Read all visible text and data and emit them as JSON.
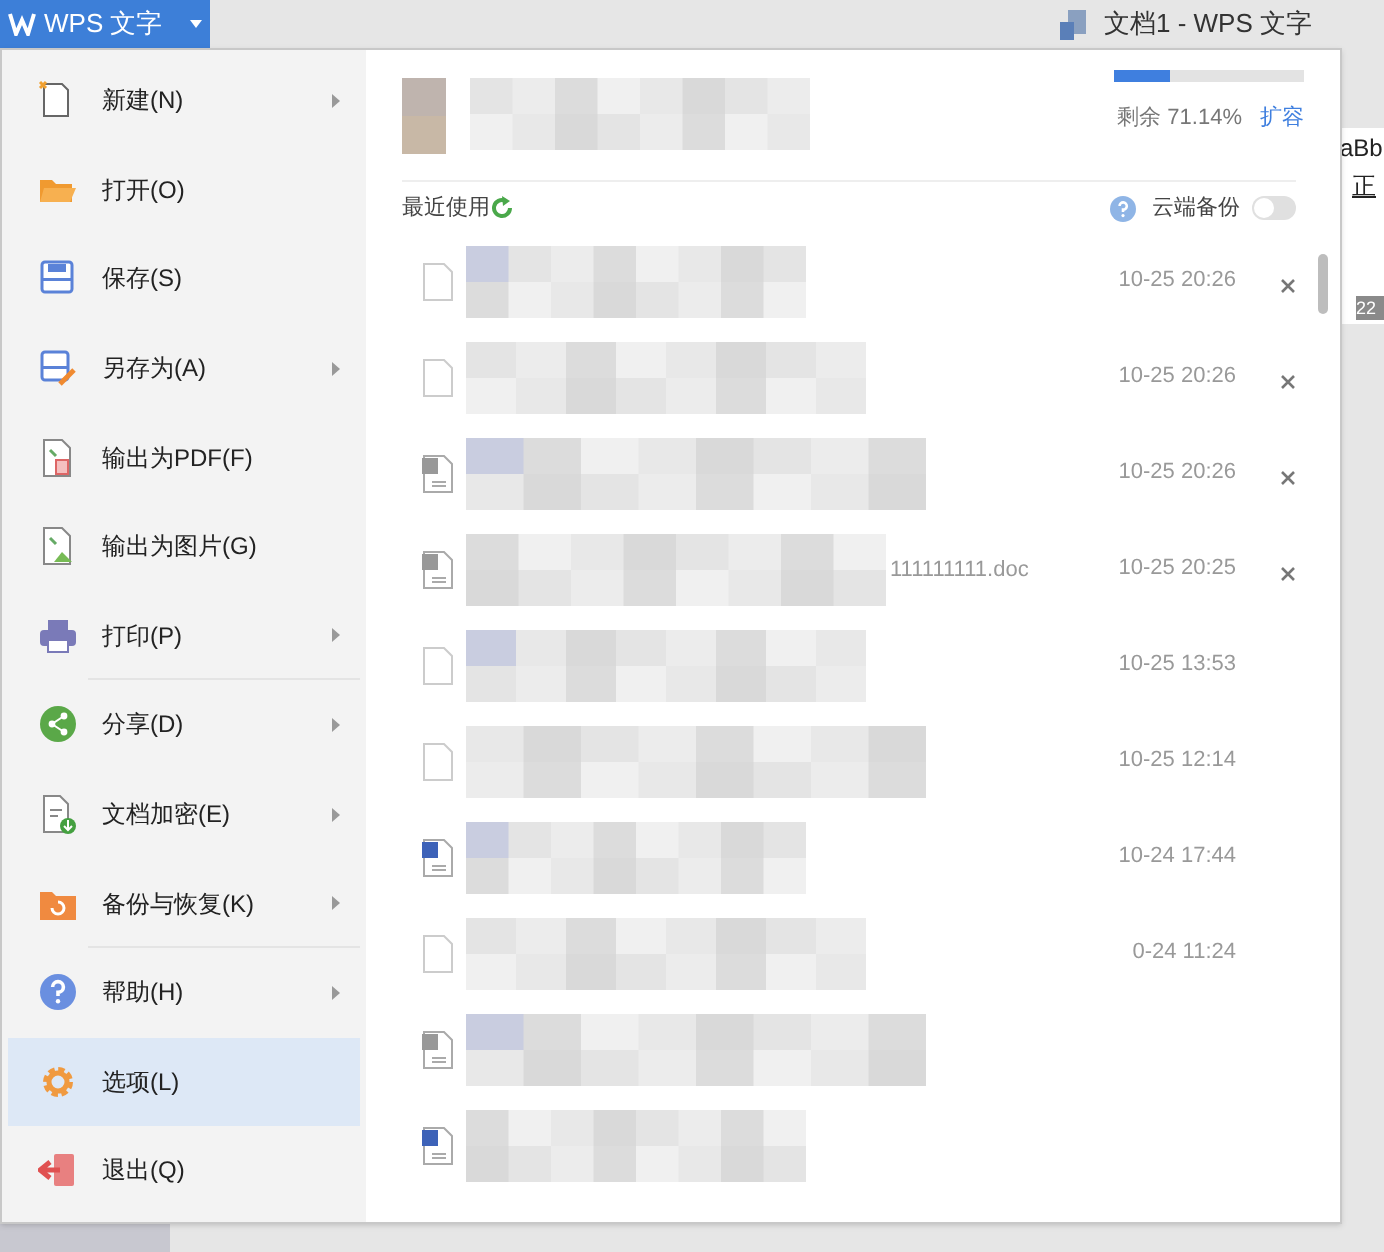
{
  "title_bar": {
    "app_button": "WPS 文字",
    "document_title": "文档1 - WPS 文字"
  },
  "menu": [
    {
      "label": "新建(N)",
      "kind": "new",
      "submenu": true,
      "selected": false,
      "divider_before": false
    },
    {
      "label": "打开(O)",
      "kind": "open",
      "submenu": false,
      "selected": false,
      "divider_before": false
    },
    {
      "label": "保存(S)",
      "kind": "save",
      "submenu": false,
      "selected": false,
      "divider_before": false
    },
    {
      "label": "另存为(A)",
      "kind": "saveas",
      "submenu": true,
      "selected": false,
      "divider_before": false
    },
    {
      "label": "输出为PDF(F)",
      "kind": "pdf",
      "submenu": false,
      "selected": false,
      "divider_before": false
    },
    {
      "label": "输出为图片(G)",
      "kind": "image",
      "submenu": false,
      "selected": false,
      "divider_before": false
    },
    {
      "label": "打印(P)",
      "kind": "print",
      "submenu": true,
      "selected": false,
      "divider_before": false
    },
    {
      "label": "分享(D)",
      "kind": "share",
      "submenu": true,
      "selected": false,
      "divider_before": true
    },
    {
      "label": "文档加密(E)",
      "kind": "encrypt",
      "submenu": true,
      "selected": false,
      "divider_before": false
    },
    {
      "label": "备份与恢复(K)",
      "kind": "backup",
      "submenu": true,
      "selected": false,
      "divider_before": false
    },
    {
      "label": "帮助(H)",
      "kind": "help",
      "submenu": true,
      "selected": false,
      "divider_before": true
    },
    {
      "label": "选项(L)",
      "kind": "options",
      "submenu": false,
      "selected": true,
      "divider_before": false
    },
    {
      "label": "退出(Q)",
      "kind": "exit",
      "submenu": false,
      "selected": false,
      "divider_before": false
    }
  ],
  "account": {
    "storage": {
      "level": 0.29,
      "remaining": "剩余 71.14%",
      "expand_link": "扩容"
    }
  },
  "recent": {
    "heading": "最近使用",
    "cloud_backup": {
      "label": "云端备份",
      "on": false
    },
    "files": [
      {
        "time": "10-25 20:26",
        "closable": true,
        "kind": "doc"
      },
      {
        "time": "10-25 20:26",
        "closable": true,
        "kind": "doc"
      },
      {
        "time": "10-25 20:26",
        "closable": true,
        "kind": "img"
      },
      {
        "name": "111111111.doc",
        "time": "10-25 20:25",
        "closable": true,
        "kind": "img"
      },
      {
        "time": "10-25 13:53",
        "closable": false,
        "kind": "doc"
      },
      {
        "time": "10-25 12:14",
        "closable": false,
        "kind": "doc"
      },
      {
        "time": "10-24 17:44",
        "closable": false,
        "kind": "word"
      },
      {
        "time": "0-24 11:24",
        "closable": false,
        "kind": "doc"
      },
      {
        "closable": false,
        "kind": "img"
      },
      {
        "closable": false,
        "kind": "word"
      }
    ]
  },
  "background_document": {
    "style_sample": "aBb",
    "style_name": "正",
    "ruler_mark": "22"
  }
}
